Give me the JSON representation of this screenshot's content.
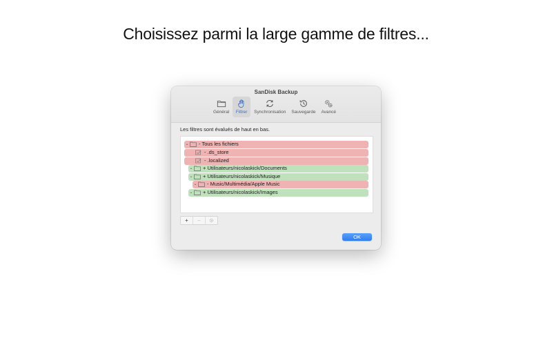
{
  "headline": "Choisissez parmi la large gamme de filtres...",
  "window": {
    "title": "SanDisk Backup",
    "toolbar": [
      {
        "label": "Général",
        "icon": "folder-icon",
        "active": false
      },
      {
        "label": "Filtrer",
        "icon": "hand-icon",
        "active": true
      },
      {
        "label": "Synchronisation",
        "icon": "sync-icon",
        "active": false
      },
      {
        "label": "Sauvegarde",
        "icon": "history-icon",
        "active": false
      },
      {
        "label": "Avancé",
        "icon": "gears-icon",
        "active": false
      }
    ],
    "description": "Les filtres sont évalués de haut en bas.",
    "filters": [
      {
        "text": "- Tous les fichiers",
        "type": "exclude",
        "item": "folder",
        "expanded": true
      },
      {
        "text": "- .ds_store",
        "type": "exclude",
        "item": "file",
        "expanded": false
      },
      {
        "text": "- .localized",
        "type": "exclude",
        "item": "file",
        "expanded": false
      },
      {
        "text": "+ Utilisateurs/nicolaskick/Documents",
        "type": "include",
        "item": "folder",
        "expanded": true
      },
      {
        "text": "+ Utilisateurs/nicolaskick/Musique",
        "type": "include",
        "item": "folder",
        "expanded": true
      },
      {
        "text": "- Music/Multimédia/Apple Music",
        "type": "exclude",
        "item": "folder",
        "expanded": true
      },
      {
        "text": "+ Utilisateurs/nicolaskick/Images",
        "type": "include",
        "item": "folder",
        "expanded": true
      }
    ],
    "bottom_buttons": {
      "add": "+",
      "remove": "−",
      "settings_icon": "gear-icon"
    },
    "ok_label": "OK",
    "colors": {
      "exclude": "#f0b3b3",
      "include": "#bfe2bd",
      "accent": "#2f7df0"
    }
  }
}
